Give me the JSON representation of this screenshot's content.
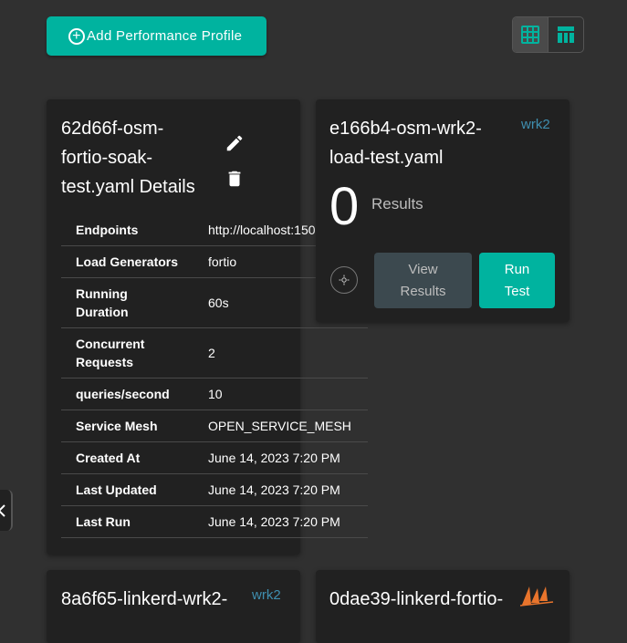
{
  "toolbar": {
    "add_profile_label": "Add Performance Profile",
    "icons": {
      "add": "add-circle-icon",
      "grid_view": "grid-view-icon",
      "table_view": "table-view-icon"
    }
  },
  "details_card": {
    "title_lines": [
      "62d66f-osm-",
      "fortio-soak-",
      "test.yaml Details"
    ],
    "icons": {
      "edit": "edit-pencil-icon",
      "delete": "delete-trash-icon"
    },
    "rows": [
      {
        "key": "Endpoints",
        "value": "http://localhost:150"
      },
      {
        "key": "Load Generators",
        "value": "fortio"
      },
      {
        "key": "Running Duration",
        "value": "60s"
      },
      {
        "key": "Concurrent Requests",
        "value": "2"
      },
      {
        "key": "queries/second",
        "value": "10"
      },
      {
        "key": "Service Mesh",
        "value": "OPEN_SERVICE_MESH"
      },
      {
        "key": "Created At",
        "value": "June 14, 2023 7:20 PM"
      },
      {
        "key": "Last Updated",
        "value": "June 14, 2023 7:20 PM"
      },
      {
        "key": "Last Run",
        "value": "June 14, 2023 7:20 PM"
      }
    ]
  },
  "results_card": {
    "title_lines": [
      "e166b4-osm-wrk2-",
      "load-test.yaml"
    ],
    "tag": "wrk2",
    "count": "0",
    "count_label": "Results",
    "view_results_lines": [
      "View",
      "Results"
    ],
    "run_test_lines": [
      "Run",
      "Test"
    ],
    "settings_icon": "gear-icon"
  },
  "card3": {
    "title": "8a6f65-linkerd-wrk2-",
    "tag": "wrk2"
  },
  "card4": {
    "title": "0dae39-linkerd-fortio-",
    "logo": "fortio-sailboat-logo"
  },
  "colors": {
    "accent": "#00b39f",
    "background": "#303030",
    "card": "#212121",
    "tag": "#3f8fb0"
  }
}
